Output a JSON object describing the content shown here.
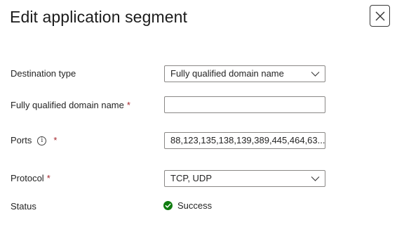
{
  "panel": {
    "title": "Edit application segment"
  },
  "close_button": {
    "icon": "close-icon"
  },
  "fields": {
    "destination_type": {
      "label": "Destination type",
      "value": "Fully qualified domain name"
    },
    "fqdn": {
      "label": "Fully qualified domain name",
      "required_mark": "*",
      "value": ""
    },
    "ports": {
      "label": "Ports",
      "info_icon": "i",
      "required_mark": "*",
      "value": "88,123,135,138,139,389,445,464,63..."
    },
    "protocol": {
      "label": "Protocol",
      "required_mark": "*",
      "value": "TCP, UDP"
    },
    "status": {
      "label": "Status",
      "value": "Success",
      "icon": "success-check-icon"
    }
  },
  "colors": {
    "required": "#a4262c",
    "success": "#107c10",
    "border": "#8a8886"
  }
}
